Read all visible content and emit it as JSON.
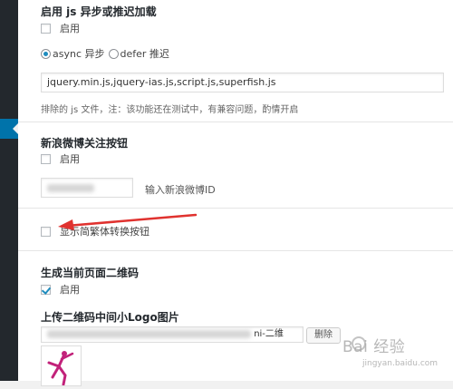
{
  "async_section": {
    "title": "启用 js 异步或推迟加载",
    "enable_label": "启用",
    "enabled": false,
    "async_label": "async 异步",
    "defer_label": "defer 推迟",
    "selected": "async",
    "excluded_files_value": "jquery.min.js,jquery-ias.js,script.js,superfish.js",
    "hint": "排除的 js 文件，注：该功能还在测试中，有兼容问题，酌情开启"
  },
  "weibo_section": {
    "title": "新浪微博关注按钮",
    "enable_label": "启用",
    "enabled": false,
    "id_hint": "输入新浪微博ID"
  },
  "convert_section": {
    "label": "显示简繁体转换按钮",
    "enabled": false
  },
  "qrcode_section": {
    "title": "生成当前页面二维码",
    "enable_label": "启用",
    "enabled": true,
    "upload_title": "上传二维码中间小Logo图片",
    "path_suffix": "ni-二维",
    "delete_label": "删除"
  },
  "watermark": {
    "text": "Bai 经验",
    "sub": "jingyan.baidu.com"
  },
  "colors": {
    "accent": "#1e8cbe",
    "sidebar": "#23282d",
    "arrow": "#e0322f"
  },
  "icons": {
    "sidebar_arrow": "triangle-left",
    "annotation": "red-arrow"
  }
}
